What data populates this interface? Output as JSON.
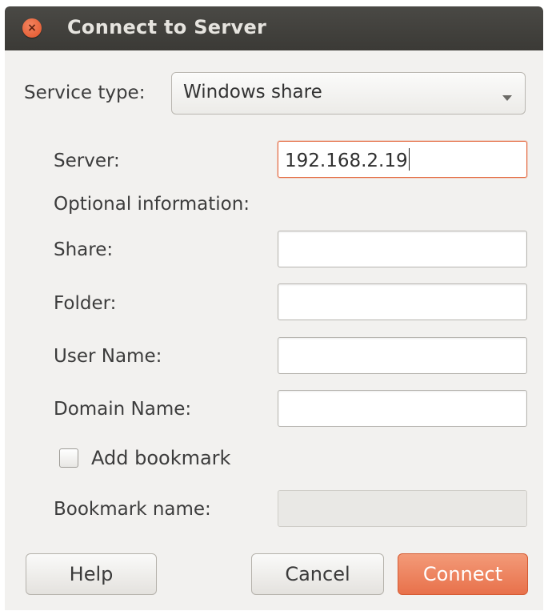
{
  "window": {
    "title": "Connect to Server",
    "close_symbol": "×"
  },
  "service": {
    "label": "Service type:",
    "selected": "Windows share"
  },
  "server": {
    "label": "Server:",
    "value": "192.168.2.19"
  },
  "optional_heading": "Optional information:",
  "share": {
    "label": "Share:",
    "value": ""
  },
  "folder": {
    "label": "Folder:",
    "value": ""
  },
  "user_name": {
    "label": "User Name:",
    "value": ""
  },
  "domain_name": {
    "label": "Domain Name:",
    "value": ""
  },
  "bookmark": {
    "checkbox_label": "Add bookmark",
    "checked": false,
    "name_label": "Bookmark name:",
    "name_value": ""
  },
  "buttons": {
    "help": "Help",
    "cancel": "Cancel",
    "connect": "Connect"
  },
  "icons": {
    "close": "close-icon",
    "dropdown": "chevron-down-icon"
  },
  "colors": {
    "accent": "#e8714b",
    "titlebar": "#3b3a36",
    "background": "#f2f1ef"
  }
}
